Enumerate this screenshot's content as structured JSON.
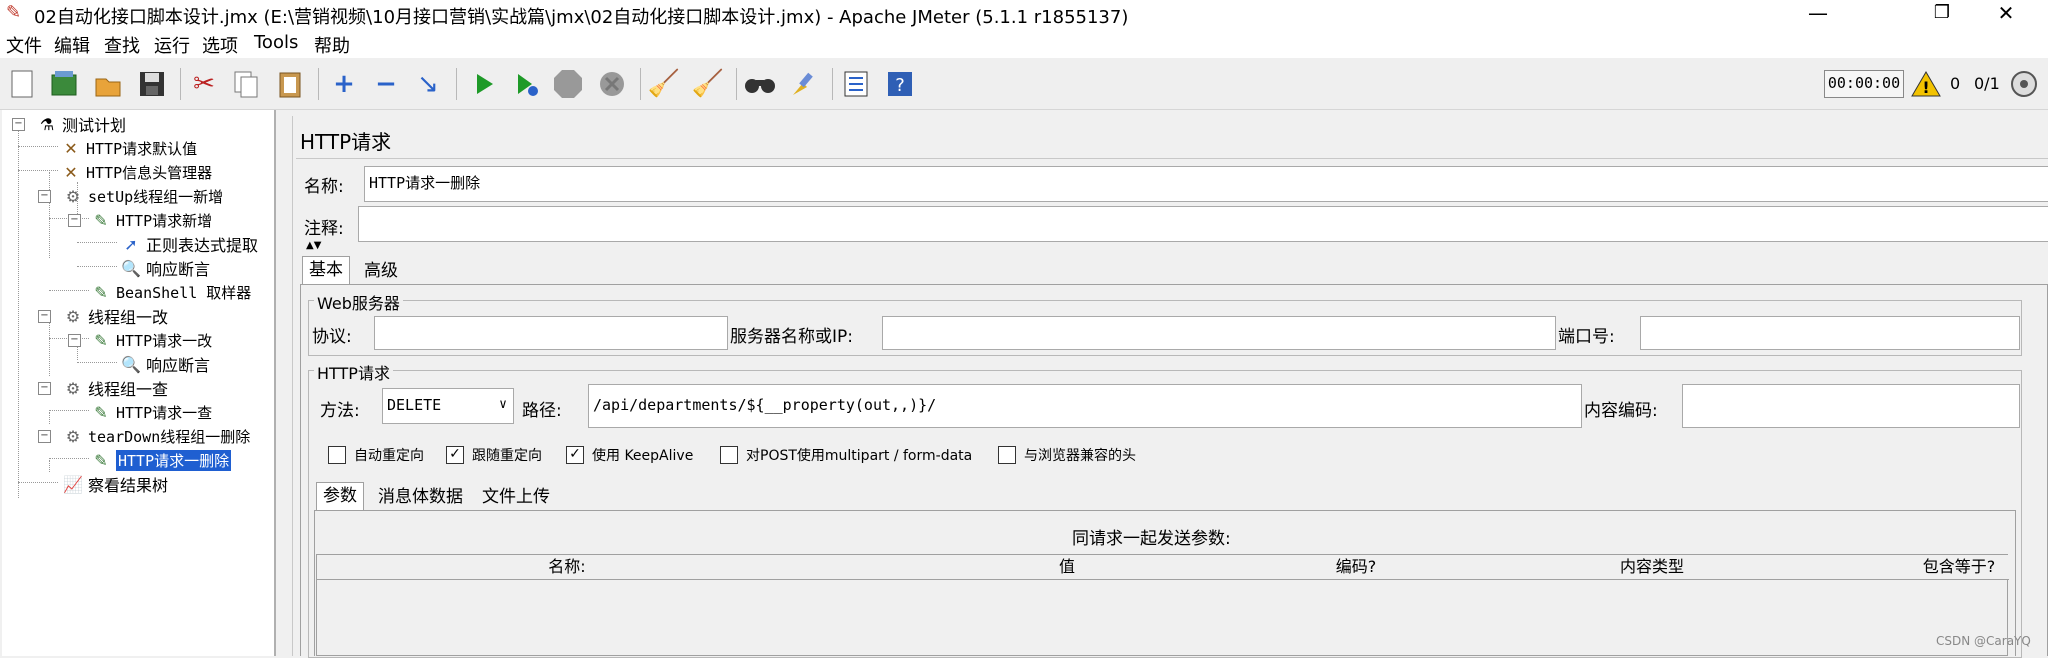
{
  "window": {
    "title": "02自动化接口脚本设计.jmx (E:\\营销视频\\10月接口营销\\实战篇\\jmx\\02自动化接口脚本设计.jmx) - Apache JMeter (5.1.1 r1855137)",
    "minimize": "—",
    "maximize": "❐",
    "close": "✕"
  },
  "menu": [
    "文件",
    "编辑",
    "查找",
    "运行",
    "选项",
    "Tools",
    "帮助"
  ],
  "toolbar": {
    "timer": "00:00:00",
    "warning_count": "0",
    "threads": "0/1"
  },
  "tree": {
    "nodes": [
      {
        "label": "测试计划",
        "icon": "test-plan-icon"
      },
      {
        "label": "HTTP请求默认值",
        "icon": "wrench-icon"
      },
      {
        "label": "HTTP信息头管理器",
        "icon": "wrench-icon"
      },
      {
        "label": "setUp线程组一新增",
        "icon": "gear-icon"
      },
      {
        "label": "HTTP请求新增",
        "icon": "pipette-icon"
      },
      {
        "label": "正则表达式提取",
        "icon": "arrow-icon"
      },
      {
        "label": "响应断言",
        "icon": "magnifier-icon"
      },
      {
        "label": "BeanShell 取样器",
        "icon": "pipette-icon"
      },
      {
        "label": "线程组一改",
        "icon": "gear-icon"
      },
      {
        "label": "HTTP请求一改",
        "icon": "pipette-icon"
      },
      {
        "label": "响应断言",
        "icon": "magnifier-icon"
      },
      {
        "label": "线程组一查",
        "icon": "gear-icon"
      },
      {
        "label": "HTTP请求一查",
        "icon": "pipette-icon"
      },
      {
        "label": "tearDown线程组一删除",
        "icon": "gear-icon"
      },
      {
        "label": "HTTP请求一删除",
        "icon": "pipette-icon"
      },
      {
        "label": "察看结果树",
        "icon": "chart-icon"
      }
    ]
  },
  "panel": {
    "title": "HTTP请求",
    "name_label": "名称:",
    "name_value": "HTTP请求一删除",
    "comment_label": "注释:",
    "comment_value": "",
    "tabs": [
      "基本",
      "高级"
    ],
    "web_server": {
      "group_title": "Web服务器",
      "protocol_label": "协议:",
      "protocol_value": "",
      "server_label": "服务器名称或IP:",
      "server_value": "",
      "port_label": "端口号:",
      "port_value": ""
    },
    "http_request": {
      "group_title": "HTTP请求",
      "method_label": "方法:",
      "method_value": "DELETE",
      "path_label": "路径:",
      "path_value": "/api/departments/${__property(out,,)}/",
      "encoding_label": "内容编码:",
      "encoding_value": ""
    },
    "checkboxes": [
      {
        "label": "自动重定向",
        "checked": false
      },
      {
        "label": "跟随重定向",
        "checked": true
      },
      {
        "label": "使用 KeepAlive",
        "checked": true
      },
      {
        "label": "对POST使用multipart / form-data",
        "checked": false
      },
      {
        "label": "与浏览器兼容的头",
        "checked": false
      }
    ],
    "param_tabs": [
      "参数",
      "消息体数据",
      "文件上传"
    ],
    "params_caption": "同请求一起发送参数:",
    "columns": [
      "名称:",
      "值",
      "编码?",
      "内容类型",
      "包含等于?"
    ]
  },
  "watermark": "CSDN @CaraYQ",
  "colors": {
    "selection": "#1f5fd1",
    "warning": "#f2c200"
  }
}
